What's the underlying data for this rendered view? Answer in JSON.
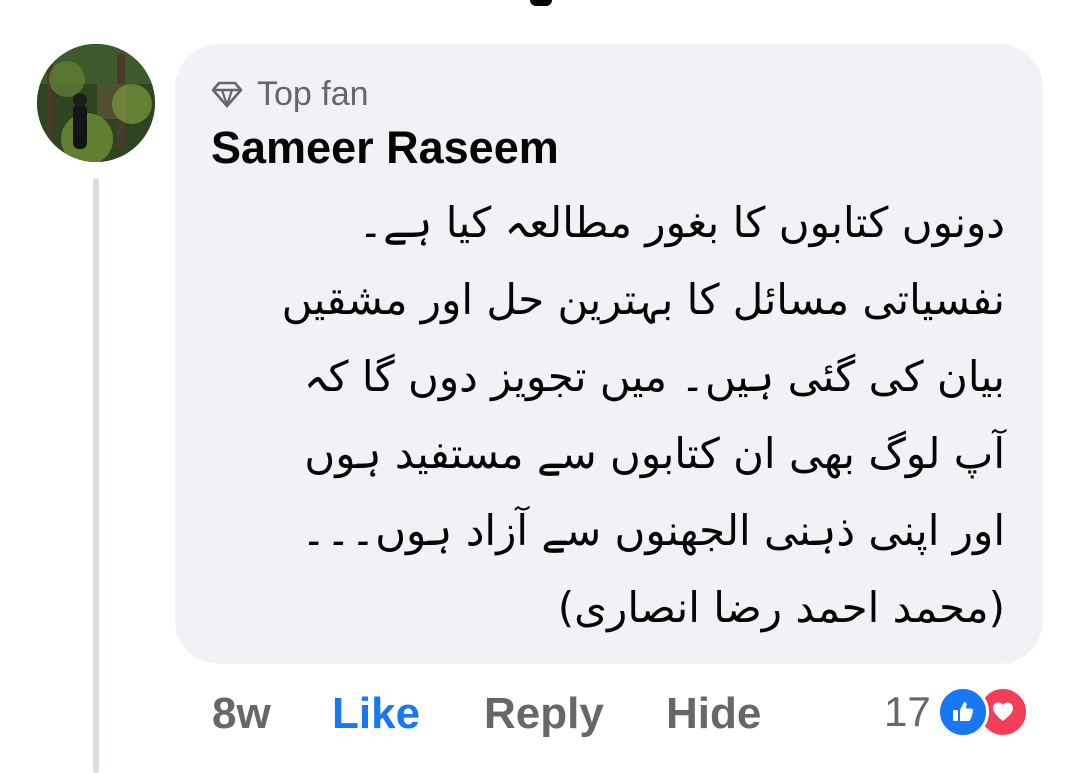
{
  "comment": {
    "badge_icon": "diamond-icon",
    "badge_label": "Top fan",
    "author_name": "Sameer Raseem",
    "body_lines": [
      "دونوں کتابوں کا بغور مطالعہ کیا ہے۔",
      "نفسیاتی مسائل کا بہترین حل اور مشقیں",
      "بیان کی گئی ہیں۔ میں تجویز دوں گا کہ",
      "آپ لوگ بھی ان کتابوں سے مستفید ہوں",
      "اور اپنی ذہنی الجھنوں سے آزاد ہوں۔۔۔",
      "(محمد احمد رضا انصاری)"
    ]
  },
  "actions": {
    "time": "8w",
    "like_label": "Like",
    "reply_label": "Reply",
    "hide_label": "Hide"
  },
  "reactions": {
    "count": "17",
    "types": [
      "like-icon",
      "love-icon"
    ]
  },
  "colors": {
    "bubble_bg": "#f0f2f5",
    "like_blue": "#1877f2",
    "love_red": "#f33e58",
    "meta_gray": "#65676b"
  }
}
